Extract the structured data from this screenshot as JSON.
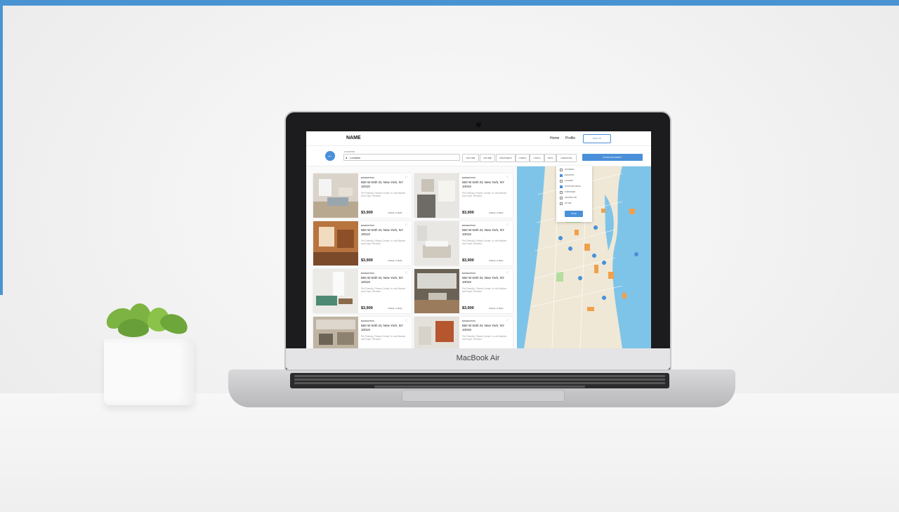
{
  "device": {
    "brand": "MacBook Air"
  },
  "app": {
    "logo": "NAME",
    "nav": {
      "home": "Home",
      "profile": "Profile",
      "signup": "SIGN UP"
    },
    "search": {
      "location_label": "LOCATION",
      "location_value": "Location",
      "filters": [
        "MAX $$$",
        "MIN $$$",
        "APARTMENT",
        "2 BEDS",
        "1 BATH",
        "PETS",
        "AMENITIES"
      ],
      "find_button": "FIND PROPERTY"
    },
    "amenities_dropdown": {
      "items": [
        {
          "label": "DOORMAN",
          "checked": false
        },
        {
          "label": "ELEVATOR",
          "checked": true
        },
        {
          "label": "LAUNDRY",
          "checked": false
        },
        {
          "label": "OUTDOOR SPACE",
          "checked": true
        },
        {
          "label": "FURNISHED",
          "checked": false
        },
        {
          "label": "CENTRAL AIR",
          "checked": false
        },
        {
          "label": "NO FEE",
          "checked": false
        }
      ],
      "save": "SAVE"
    },
    "listings": [
      {
        "area": "MANHATTAN",
        "address": "550 W 54th St, New York, NY 10019",
        "desc": "Pet Friendly, Fitness Center, In unit Washer and Dryer, Elevator",
        "price": "$3,900",
        "beds": "2 Beds  |  1 Bath"
      },
      {
        "area": "MANHATTAN",
        "address": "550 W 54th St, New York, NY 10019",
        "desc": "Pet Friendly, Fitness Center, In unit Washer and Dryer, Elevator",
        "price": "$3,900",
        "beds": "2 Beds  |  1 Bath"
      },
      {
        "area": "MANHATTAN",
        "address": "550 W 54th St, New York, NY 10019",
        "desc": "Pet Friendly, Fitness Center, In unit Washer and Dryer, Elevator",
        "price": "$3,900",
        "beds": "2 Beds  |  1 Bath"
      },
      {
        "area": "MANHATTAN",
        "address": "550 W 54th St, New York, NY 10019",
        "desc": "Pet Friendly, Fitness Center, In unit Washer and Dryer, Elevator",
        "price": "$3,900",
        "beds": "2 Beds  |  1 Bath"
      },
      {
        "area": "MANHATTAN",
        "address": "550 W 54th St, New York, NY 10019",
        "desc": "Pet Friendly, Fitness Center, In unit Washer and Dryer, Elevator",
        "price": "$3,900",
        "beds": "2 Beds  |  1 Bath"
      },
      {
        "area": "MANHATTAN",
        "address": "550 W 54th St, New York, NY 10019",
        "desc": "Pet Friendly, Fitness Center, In unit Washer and Dryer, Elevator",
        "price": "$3,900",
        "beds": "2 Beds  |  1 Bath"
      },
      {
        "area": "MANHATTAN",
        "address": "550 W 54th St, New York, NY 10019",
        "desc": "Pet Friendly, Fitness Center, In unit Washer and Dryer, Elevator",
        "price": "",
        "beds": ""
      },
      {
        "area": "MANHATTAN",
        "address": "550 W 54th St, New York, NY 10019",
        "desc": "Pet Friendly, Fitness Center, In unit Washer and Dryer, Elevator",
        "price": "",
        "beds": ""
      }
    ],
    "colors": {
      "accent": "#4a90d9",
      "water": "#7ec4e8",
      "park": "#b7dca0",
      "poi": "#f0a04b"
    }
  }
}
